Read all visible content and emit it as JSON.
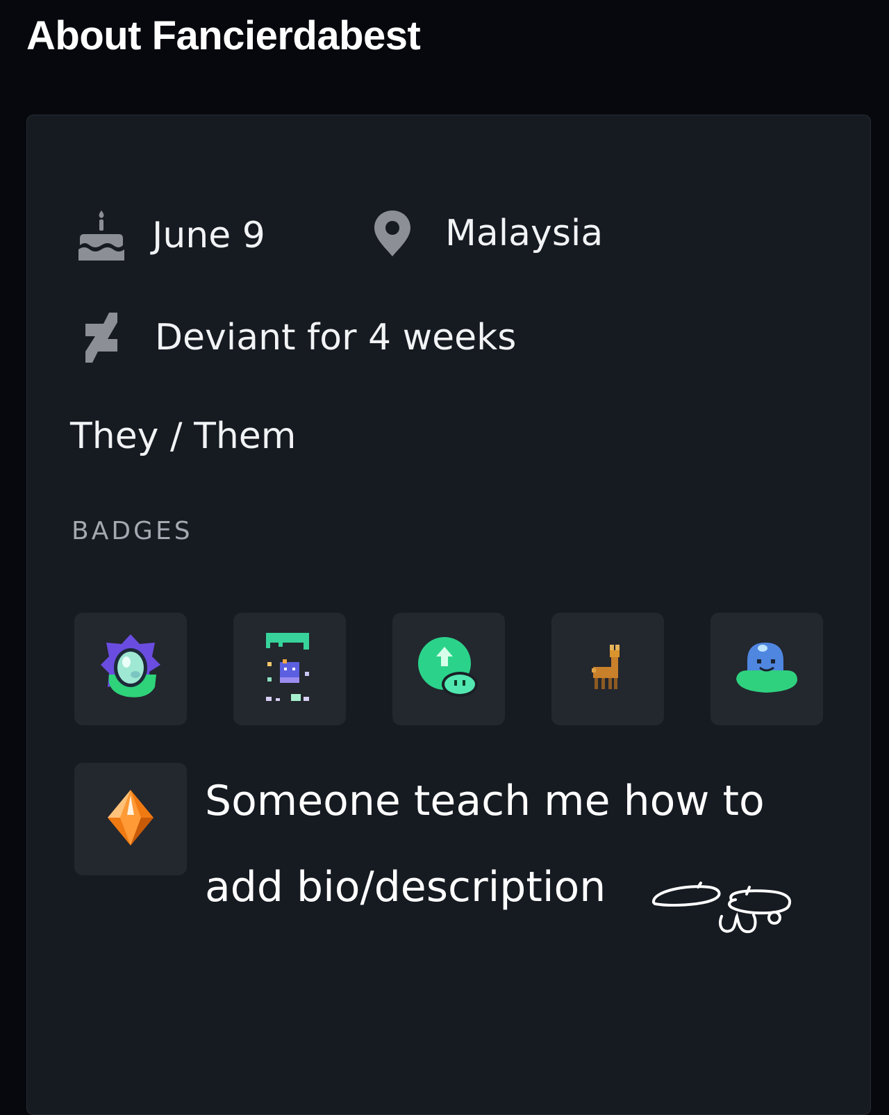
{
  "header": {
    "title": "About Fancierdabest"
  },
  "profile": {
    "birthday": "June 9",
    "location": "Malaysia",
    "membership": "Deviant for 4 weeks",
    "pronouns": "They / Them"
  },
  "badges": {
    "heading": "BADGES",
    "items": [
      {
        "icon": "egg-badge-icon"
      },
      {
        "icon": "pixel-creature-badge-icon"
      },
      {
        "icon": "upvote-blob-badge-icon"
      },
      {
        "icon": "llama-badge-icon"
      },
      {
        "icon": "slime-badge-icon"
      },
      {
        "icon": "orange-gem-badge-icon"
      }
    ]
  },
  "handwritten_note": {
    "line1": "Someone teach me how to",
    "line2": "add bio/description"
  },
  "colors": {
    "background": "#07080d",
    "card": "#161a21",
    "badge_tile": "#23272e",
    "icon_gray": "#8c8f96",
    "muted_text": "#a3a8b1"
  }
}
